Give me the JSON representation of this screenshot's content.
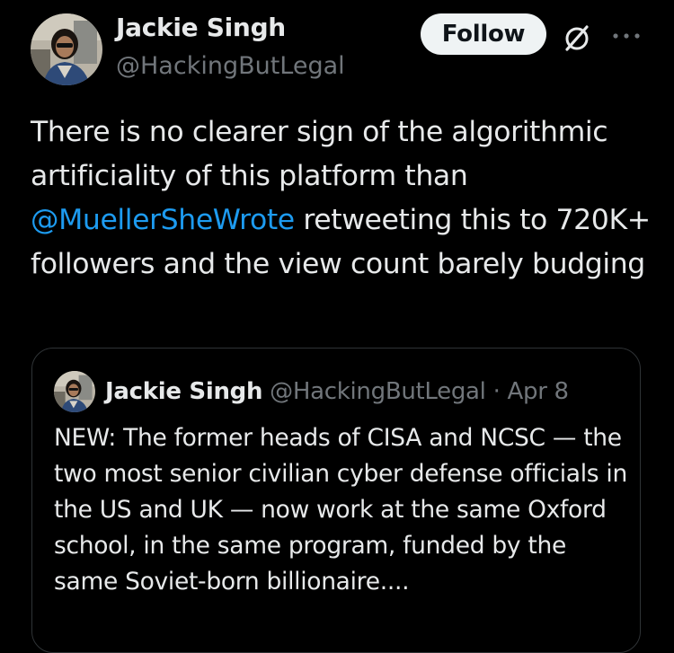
{
  "tweet": {
    "author_name": "Jackie Singh",
    "author_handle": "@HackingButLegal",
    "follow_label": "Follow",
    "text_before_mention": "There is no clearer sign of the algorithmic artificiality of this platform than ",
    "mention": "@MuellerSheWrote",
    "text_after_mention": " retweeting this to 720K+ followers and the view count barely budging"
  },
  "quote": {
    "author_name": "Jackie Singh",
    "author_handle": "@HackingButLegal",
    "separator": "·",
    "date": "Apr 8",
    "text": "NEW: The former heads of CISA and NCSC — the two most senior civilian cyber defense officials in the US and UK — now work at the same Oxford school, in the same program, funded by the same Soviet-born billionaire...."
  },
  "icons": {
    "avatar": "avatar",
    "grok": "grok-icon",
    "more": "more-horizontal-icon"
  },
  "colors": {
    "background": "#000000",
    "primary_text": "#e7e9ea",
    "secondary_text": "#71767b",
    "link": "#1d9bf0",
    "follow_button_bg": "#eff3f4",
    "border": "#2f3336"
  }
}
